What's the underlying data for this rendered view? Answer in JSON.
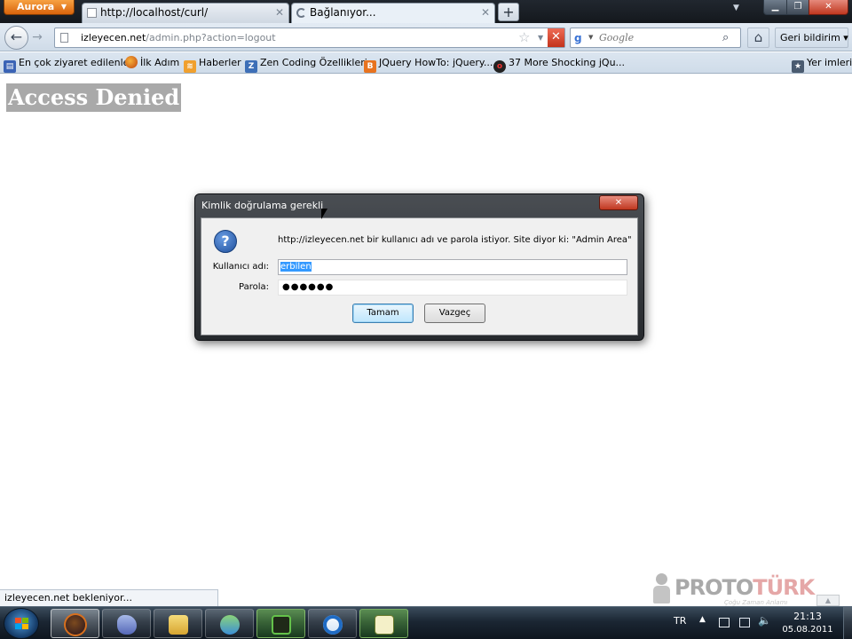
{
  "browser": {
    "app_button_label": "Aurora",
    "tabs": [
      {
        "label": "http://localhost/curl/"
      },
      {
        "label": "Bağlanıyor..."
      }
    ],
    "new_tab_glyph": "+"
  },
  "navbar": {
    "url_host": "izleyecen.net",
    "url_path": "/admin.php?action=logout",
    "search_placeholder": "Google",
    "feedback_label": "Geri bildirim ▾"
  },
  "bookmarks": [
    {
      "label": "En çok ziyaret edilenler"
    },
    {
      "label": "İlk Adım"
    },
    {
      "label": "Haberler"
    },
    {
      "label": "Zen Coding Özellikleri"
    },
    {
      "label": "JQuery HowTo: jQuery..."
    },
    {
      "label": "37 More Shocking jQu..."
    },
    {
      "label": "Yer imleri"
    }
  ],
  "page": {
    "heading": "Access Denied"
  },
  "auth_dialog": {
    "title": "Kimlik doğrulama gerekli",
    "message": "http://izleyecen.net bir kullanıcı adı ve parola istiyor. Site diyor ki: \"Admin Area\"",
    "username_label": "Kullanıcı adı:",
    "username_value": "erbilen",
    "password_label": "Parola:",
    "password_mask": "●●●●●●",
    "ok_label": "Tamam",
    "cancel_label": "Vazgeç"
  },
  "status_text": "izleyecen.net bekleniyor...",
  "watermark": {
    "brand_a": "PROTO",
    "brand_b": "TÜRK",
    "tagline": "Çoğu Zaman Anlamı"
  },
  "taskbar": {
    "language": "TR",
    "time": "21:13",
    "date": "05.08.2011"
  },
  "colors": {
    "app_button": "#e07318",
    "dialog_close": "#c0371f",
    "selection": "#3399ff",
    "heading_bg": "#a9a9a9"
  }
}
